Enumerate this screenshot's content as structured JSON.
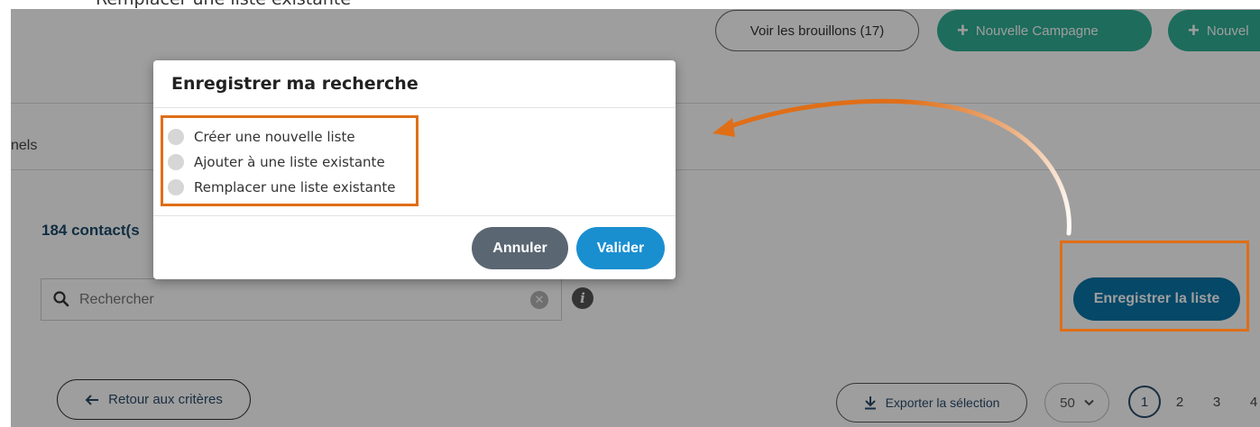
{
  "caption": "Remplacer une liste existante",
  "header": {
    "drafts_button": "Voir les brouillons (17)",
    "new_campaign_button": "Nouvelle Campagne",
    "new_second_button": "Nouvel"
  },
  "tabs": {
    "partial_label": "nels"
  },
  "results": {
    "count_label": "184 contact(s"
  },
  "search": {
    "placeholder": "Rechercher",
    "clear_glyph": "✕",
    "info_glyph": "i"
  },
  "actions": {
    "save_list_button": "Enregistrer la liste",
    "back_button": "Retour aux critères",
    "export_button": "Exporter la sélection",
    "per_page_value": "50",
    "pages": [
      "1",
      "2",
      "3",
      "4"
    ],
    "current_page": "1"
  },
  "modal": {
    "title": "Enregistrer ma recherche",
    "options": [
      {
        "label": "Créer une nouvelle liste"
      },
      {
        "label": "Ajouter à une liste existante"
      },
      {
        "label": "Remplacer une liste existante"
      }
    ],
    "cancel_button": "Annuler",
    "validate_button": "Valider"
  },
  "colors": {
    "accent_green": "#2fae95",
    "primary_blue": "#0a74a8",
    "validate_blue": "#1a8fd0",
    "cancel_gray": "#5a6672",
    "annotation_orange": "#e06e17"
  },
  "icons": {
    "plus": "plus-icon",
    "search": "search-icon",
    "clear": "clear-icon",
    "info": "info-icon",
    "back_arrow": "arrow-left-icon",
    "download": "download-icon",
    "chevron": "chevron-down-icon",
    "annotation_arrow": "annotation-arrow"
  }
}
